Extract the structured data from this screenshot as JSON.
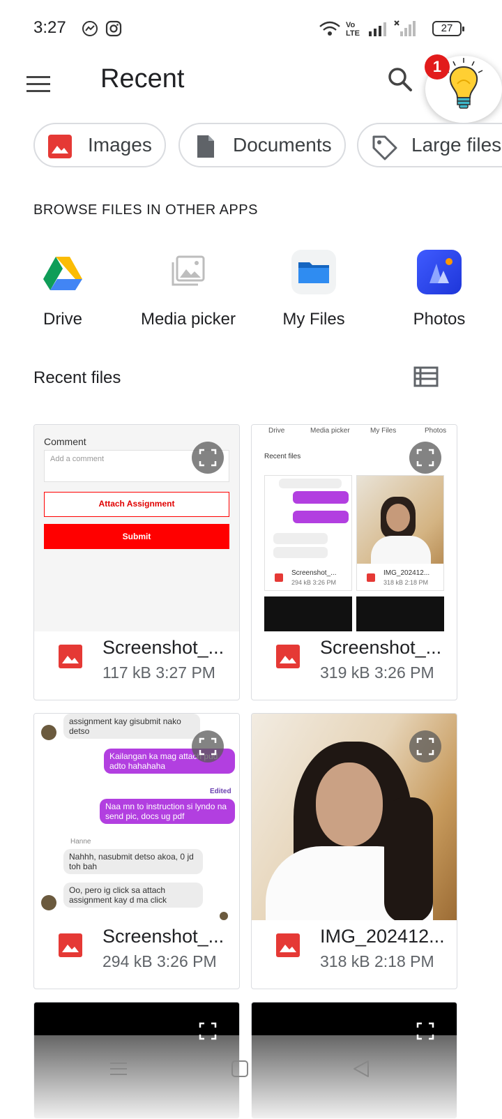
{
  "status_bar": {
    "time": "3:27",
    "battery": "27"
  },
  "app_bar": {
    "title": "Recent",
    "tip_badge": "1"
  },
  "chips": [
    {
      "label": "Images"
    },
    {
      "label": "Documents"
    },
    {
      "label": "Large files"
    }
  ],
  "browse": {
    "heading": "BROWSE FILES IN OTHER APPS",
    "apps": [
      {
        "label": "Drive"
      },
      {
        "label": "Media picker"
      },
      {
        "label": "My Files"
      },
      {
        "label": "Photos"
      }
    ]
  },
  "recent": {
    "heading": "Recent files",
    "files": [
      {
        "name": "Screenshot_...",
        "size": "117 kB",
        "time": "3:27 PM"
      },
      {
        "name": "Screenshot_...",
        "size": "319 kB",
        "time": "3:26 PM"
      },
      {
        "name": "Screenshot_...",
        "size": "294 kB",
        "time": "3:26 PM"
      },
      {
        "name": "IMG_202412...",
        "size": "318 kB",
        "time": "2:18 PM"
      }
    ]
  },
  "thumb1": {
    "comment_label": "Comment",
    "comment_placeholder": "Add a comment",
    "attach_button": "Attach Assignment",
    "submit_button": "Submit"
  },
  "thumb2": {
    "tabs": [
      "Drive",
      "Media picker",
      "My Files",
      "Photos"
    ],
    "heading": "Recent files",
    "files": [
      {
        "name": "Screenshot_...",
        "meta": "294 kB 3:26 PM"
      },
      {
        "name": "IMG_202412...",
        "meta": "318 kB 2:18 PM"
      }
    ]
  },
  "thumb3": {
    "msg1": "assignment kay gisubmit nako detso",
    "msg2": "Kailangan ka mag attach pud adto hahahaha",
    "edited": "Edited",
    "msg3": "Naa mn to instruction si lyndo na send pic, docs ug pdf",
    "sender": "Hanne",
    "msg4": "Nahhh, nasubmit detso akoa, 0 jd toh bah",
    "msg5": "Oo, pero ig click sa attach assignment kay d ma click"
  },
  "colors": {
    "image_icon_red": "#e53935",
    "submit_red": "#ff0000",
    "purple_bubble": "#b23fe0",
    "badge_red": "#e21b1b"
  }
}
